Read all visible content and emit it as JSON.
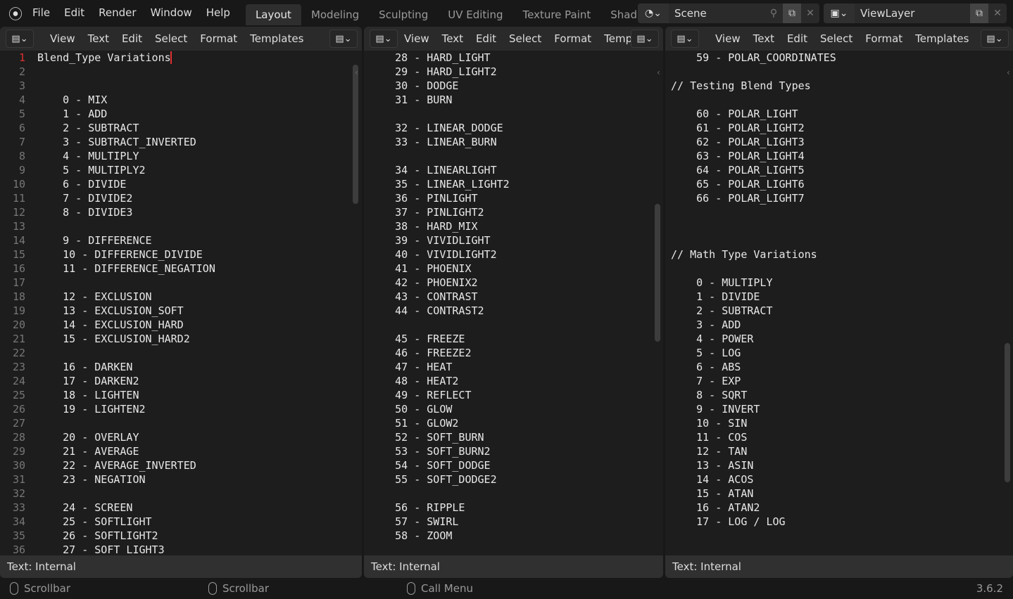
{
  "topbar": {
    "menus": [
      "File",
      "Edit",
      "Render",
      "Window",
      "Help"
    ],
    "workspaces": [
      "Layout",
      "Modeling",
      "Sculpting",
      "UV Editing",
      "Texture Paint",
      "Shadi"
    ],
    "active_workspace": "Layout",
    "scene": "Scene",
    "view_layer": "ViewLayer"
  },
  "editor_menus": [
    "View",
    "Text",
    "Edit",
    "Select",
    "Format",
    "Templates"
  ],
  "pane1": {
    "footer": "Text: Internal",
    "start_line": 1,
    "lines": [
      "Blend_Type Variations",
      "",
      "",
      "    0 - MIX",
      "    1 - ADD",
      "    2 - SUBTRACT",
      "    3 - SUBTRACT_INVERTED",
      "    4 - MULTIPLY",
      "    5 - MULTIPLY2",
      "    6 - DIVIDE",
      "    7 - DIVIDE2",
      "    8 - DIVIDE3",
      "",
      "    9 - DIFFERENCE",
      "    10 - DIFFERENCE_DIVIDE",
      "    11 - DIFFERENCE_NEGATION",
      "",
      "    12 - EXCLUSION",
      "    13 - EXCLUSION_SOFT",
      "    14 - EXCLUSION_HARD",
      "    15 - EXCLUSION_HARD2",
      "",
      "    16 - DARKEN",
      "    17 - DARKEN2",
      "    18 - LIGHTEN",
      "    19 - LIGHTEN2",
      "",
      "    20 - OVERLAY",
      "    21 - AVERAGE",
      "    22 - AVERAGE_INVERTED",
      "    23 - NEGATION",
      "",
      "    24 - SCREEN",
      "    25 - SOFTLIGHT",
      "    26 - SOFTLIGHT2",
      "    27 - SOFT_LIGHT3"
    ]
  },
  "pane2": {
    "footer": "Text: Internal",
    "lines": [
      "    28 - HARD_LIGHT",
      "    29 - HARD_LIGHT2",
      "    30 - DODGE",
      "    31 - BURN",
      "",
      "    32 - LINEAR_DODGE",
      "    33 - LINEAR_BURN",
      "",
      "    34 - LINEARLIGHT",
      "    35 - LINEAR_LIGHT2",
      "    36 - PINLIGHT",
      "    37 - PINLIGHT2",
      "    38 - HARD_MIX",
      "    39 - VIVIDLIGHT",
      "    40 - VIVIDLIGHT2",
      "    41 - PHOENIX",
      "    42 - PHOENIX2",
      "    43 - CONTRAST",
      "    44 - CONTRAST2",
      "",
      "    45 - FREEZE",
      "    46 - FREEZE2",
      "    47 - HEAT",
      "    48 - HEAT2",
      "    49 - REFLECT",
      "    50 - GLOW",
      "    51 - GLOW2",
      "    52 - SOFT_BURN",
      "    53 - SOFT_BURN2",
      "    54 - SOFT_DODGE",
      "    55 - SOFT_DODGE2",
      "",
      "    56 - RIPPLE",
      "    57 - SWIRL",
      "    58 - ZOOM"
    ]
  },
  "pane3": {
    "footer": "Text: Internal",
    "lines": [
      "    59 - POLAR_COORDINATES",
      "",
      "// Testing Blend Types",
      "",
      "    60 - POLAR_LIGHT",
      "    61 - POLAR_LIGHT2",
      "    62 - POLAR_LIGHT3",
      "    63 - POLAR_LIGHT4",
      "    64 - POLAR_LIGHT5",
      "    65 - POLAR_LIGHT6",
      "    66 - POLAR_LIGHT7",
      "",
      "",
      "",
      "// Math Type Variations",
      "",
      "    0 - MULTIPLY",
      "    1 - DIVIDE",
      "    2 - SUBTRACT",
      "    3 - ADD",
      "    4 - POWER",
      "    5 - LOG",
      "    6 - ABS",
      "    7 - EXP",
      "    8 - SQRT",
      "    9 - INVERT",
      "    10 - SIN",
      "    11 - COS",
      "    12 - TAN",
      "    13 - ASIN",
      "    14 - ACOS",
      "    15 - ATAN",
      "    16 - ATAN2",
      "    17 - LOG / LOG"
    ]
  },
  "status": {
    "items": [
      "Scrollbar",
      "Scrollbar",
      "Call Menu"
    ],
    "version": "3.6.2"
  },
  "colors": {
    "cursor": "#e03030",
    "background": "#1d1d1d",
    "header": "#2a2a2a"
  }
}
